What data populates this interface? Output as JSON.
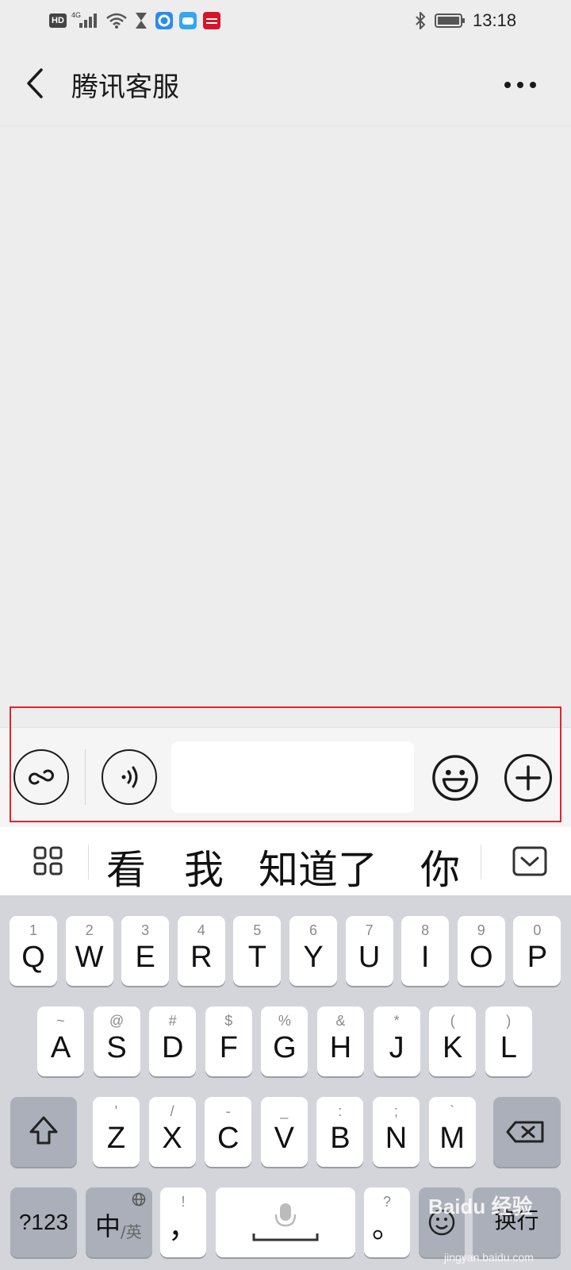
{
  "status_bar": {
    "hd": "HD",
    "network": "4G",
    "time": "13:18"
  },
  "nav": {
    "title": "腾讯客服"
  },
  "candidates": [
    "看",
    "我",
    "知道了",
    "你"
  ],
  "keyboard": {
    "row1": [
      {
        "sub": "1",
        "main": "Q"
      },
      {
        "sub": "2",
        "main": "W"
      },
      {
        "sub": "3",
        "main": "E"
      },
      {
        "sub": "4",
        "main": "R"
      },
      {
        "sub": "5",
        "main": "T"
      },
      {
        "sub": "6",
        "main": "Y"
      },
      {
        "sub": "7",
        "main": "U"
      },
      {
        "sub": "8",
        "main": "I"
      },
      {
        "sub": "9",
        "main": "O"
      },
      {
        "sub": "0",
        "main": "P"
      }
    ],
    "row2": [
      {
        "sub": "~",
        "main": "A"
      },
      {
        "sub": "@",
        "main": "S"
      },
      {
        "sub": "#",
        "main": "D"
      },
      {
        "sub": "$",
        "main": "F"
      },
      {
        "sub": "%",
        "main": "G"
      },
      {
        "sub": "&",
        "main": "H"
      },
      {
        "sub": "*",
        "main": "J"
      },
      {
        "sub": "(",
        "main": "K"
      },
      {
        "sub": ")",
        "main": "L"
      }
    ],
    "row3": [
      {
        "sub": "'",
        "main": "Z"
      },
      {
        "sub": "/",
        "main": "X"
      },
      {
        "sub": "-",
        "main": "C"
      },
      {
        "sub": "_",
        "main": "V"
      },
      {
        "sub": ":",
        "main": "B"
      },
      {
        "sub": ";",
        "main": "N"
      },
      {
        "sub": "`",
        "main": "M"
      }
    ],
    "num_key": "?123",
    "lang_main": "中",
    "lang_sub": "/英",
    "comma_sub": "!",
    "comma_main": "，",
    "period_sub": "?",
    "period_main": "。",
    "enter_label": "换行"
  },
  "watermark": {
    "logo": "Baidu 经验",
    "url": "jingyan.baidu.com"
  },
  "colors": {
    "highlight": "#e0262b",
    "background": "#ededed",
    "keyboard": "#d3d5db"
  }
}
